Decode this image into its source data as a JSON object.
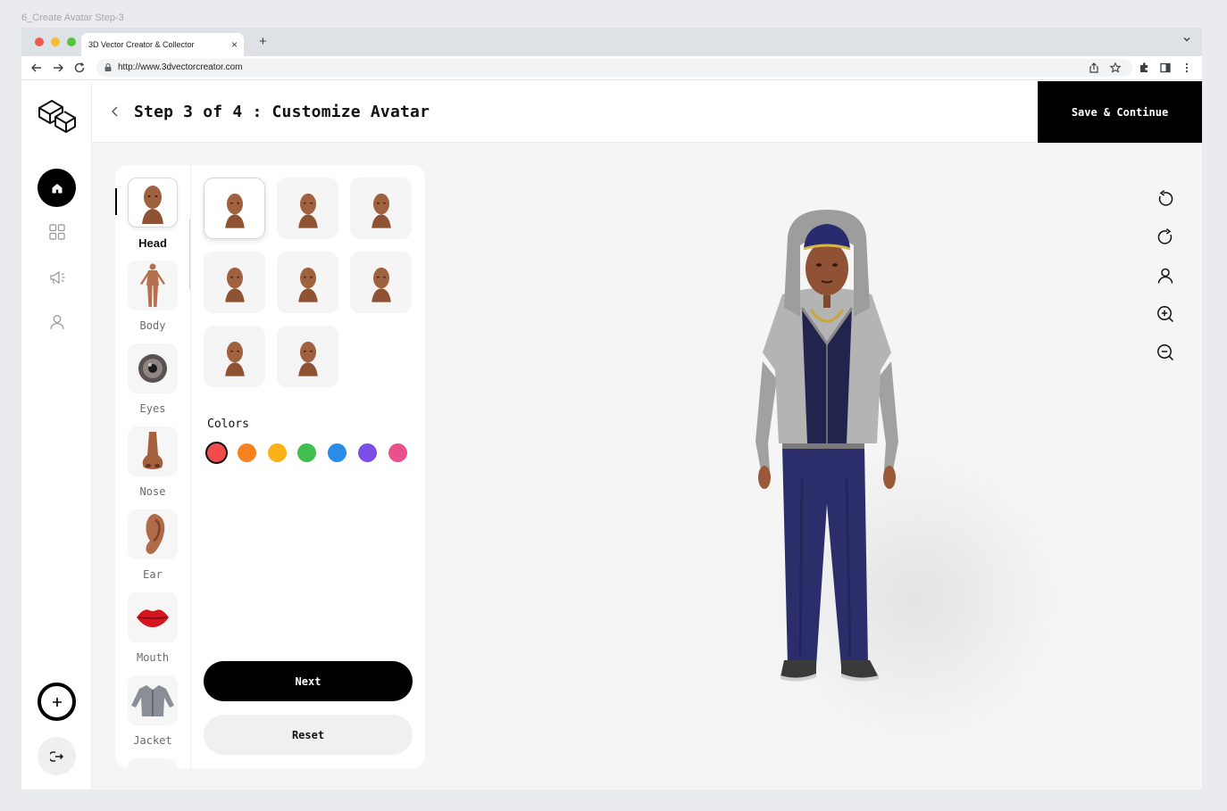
{
  "frame_label": "6_Create Avatar Step-3",
  "browser": {
    "tab_title": "3D Vector Creator & Collector",
    "url": "http://www.3dvectorcreator.com"
  },
  "header": {
    "title": "Step 3 of 4 : Customize Avatar",
    "save_label": "Save & Continue"
  },
  "categories": [
    {
      "label": "Head",
      "icon": "head-icon"
    },
    {
      "label": "Body",
      "icon": "body-icon"
    },
    {
      "label": "Eyes",
      "icon": "eye-icon"
    },
    {
      "label": "Nose",
      "icon": "nose-icon"
    },
    {
      "label": "Ear",
      "icon": "ear-icon"
    },
    {
      "label": "Mouth",
      "icon": "mouth-icon"
    },
    {
      "label": "Jacket",
      "icon": "jacket-icon"
    }
  ],
  "selected_category": "Head",
  "head_options_count": 8,
  "selected_option": 1,
  "colors": {
    "label": "Colors",
    "swatches": [
      "#f24b4b",
      "#f5821f",
      "#fbb117",
      "#3fbf4f",
      "#2a8be8",
      "#7b4fe6",
      "#e8518b"
    ],
    "selected": "#f24b4b"
  },
  "actions": {
    "next_label": "Next",
    "reset_label": "Reset"
  }
}
